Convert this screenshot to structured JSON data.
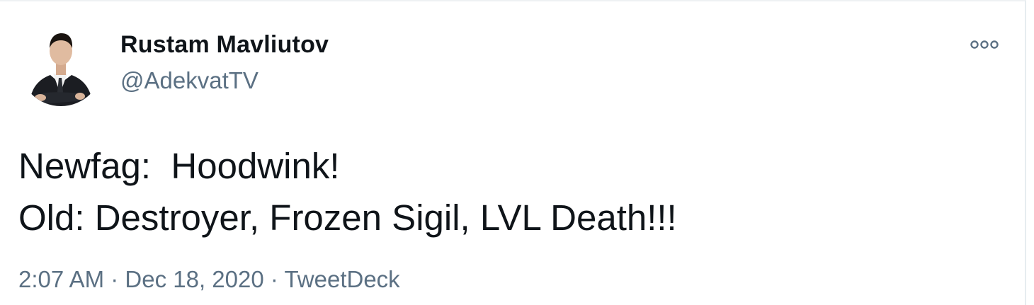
{
  "tweet": {
    "author": {
      "display_name": "Rustam Mavliutov",
      "handle": "@AdekvatTV"
    },
    "text_lines": [
      "Newfag:  Hoodwink!",
      "Old: Destroyer, Frozen Sigil, LVL Death!!!"
    ],
    "time": "2:07 AM",
    "separator": " · ",
    "date": "Dec 18, 2020",
    "source": "TweetDeck"
  },
  "colors": {
    "text_primary": "#0f1419",
    "text_secondary": "#5b7083",
    "border": "#e6ecf0"
  },
  "icons": {
    "more": "more-options-icon",
    "avatar": "avatar"
  }
}
